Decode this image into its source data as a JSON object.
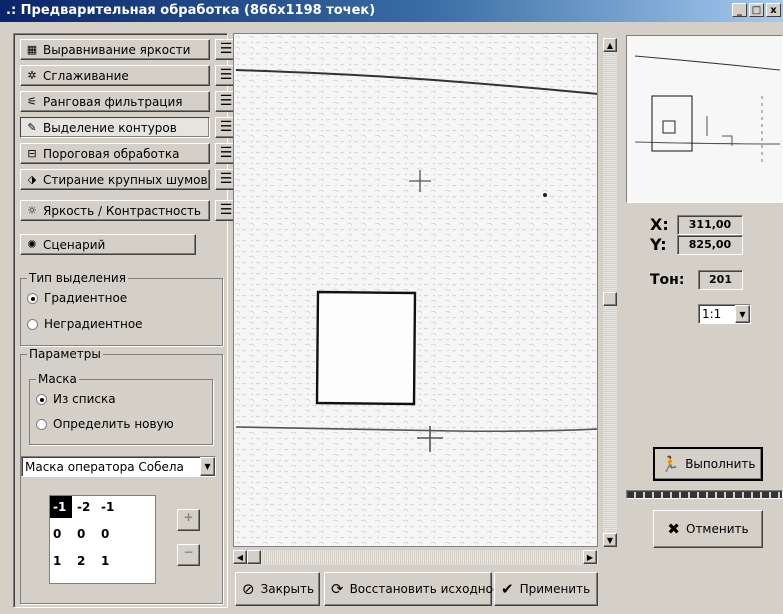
{
  "window": {
    "title": ".: Предварительная обработка (866x1198 точек)",
    "buttons": {
      "minimize": "_",
      "maximize": "□",
      "close": "x"
    }
  },
  "tools": [
    {
      "label": "Выравнивание яркости",
      "icon": "histogram-icon"
    },
    {
      "label": "Сглаживание",
      "icon": "smooth-icon"
    },
    {
      "label": "Ранговая фильтрация",
      "icon": "rank-filter-icon"
    },
    {
      "label": "Выделение контуров",
      "icon": "pencil-icon",
      "active": true
    },
    {
      "label": "Пороговая обработка",
      "icon": "threshold-icon"
    },
    {
      "label": "Стирание крупных шумов",
      "icon": "eraser-icon"
    },
    {
      "label": "Яркость / Контрастность",
      "icon": "brightness-icon"
    },
    {
      "label": "Сценарий",
      "icon": "script-icon"
    }
  ],
  "selection_type": {
    "legend": "Тип выделения",
    "options": [
      "Градиентное",
      "Неградиентное"
    ],
    "selected": "Градиентное"
  },
  "params": {
    "legend": "Параметры",
    "mask": {
      "legend": "Маска",
      "options": [
        "Из списка",
        "Определить новую"
      ],
      "selected": "Из списка"
    },
    "operator": "Маска оператора Собела",
    "matrix": [
      [
        "-1",
        "-2",
        "-1"
      ],
      [
        "0",
        "0",
        "0"
      ],
      [
        "1",
        "2",
        "1"
      ]
    ],
    "plus": "+",
    "minus": "−"
  },
  "buttons": {
    "close": "Закрыть",
    "restore": "Восстановить исходное",
    "apply": "Применить",
    "run": "Выполнить",
    "cancel": "Отменить"
  },
  "coords": {
    "x_label": "X:",
    "x": "311,00",
    "y_label": "Y:",
    "y": "825,00",
    "tone_label": "Тон:",
    "tone": "201"
  },
  "zoom": "1:1",
  "colors": {
    "title_start": "#0a246a",
    "title_end": "#a6caf0",
    "face": "#d4d0c8"
  }
}
